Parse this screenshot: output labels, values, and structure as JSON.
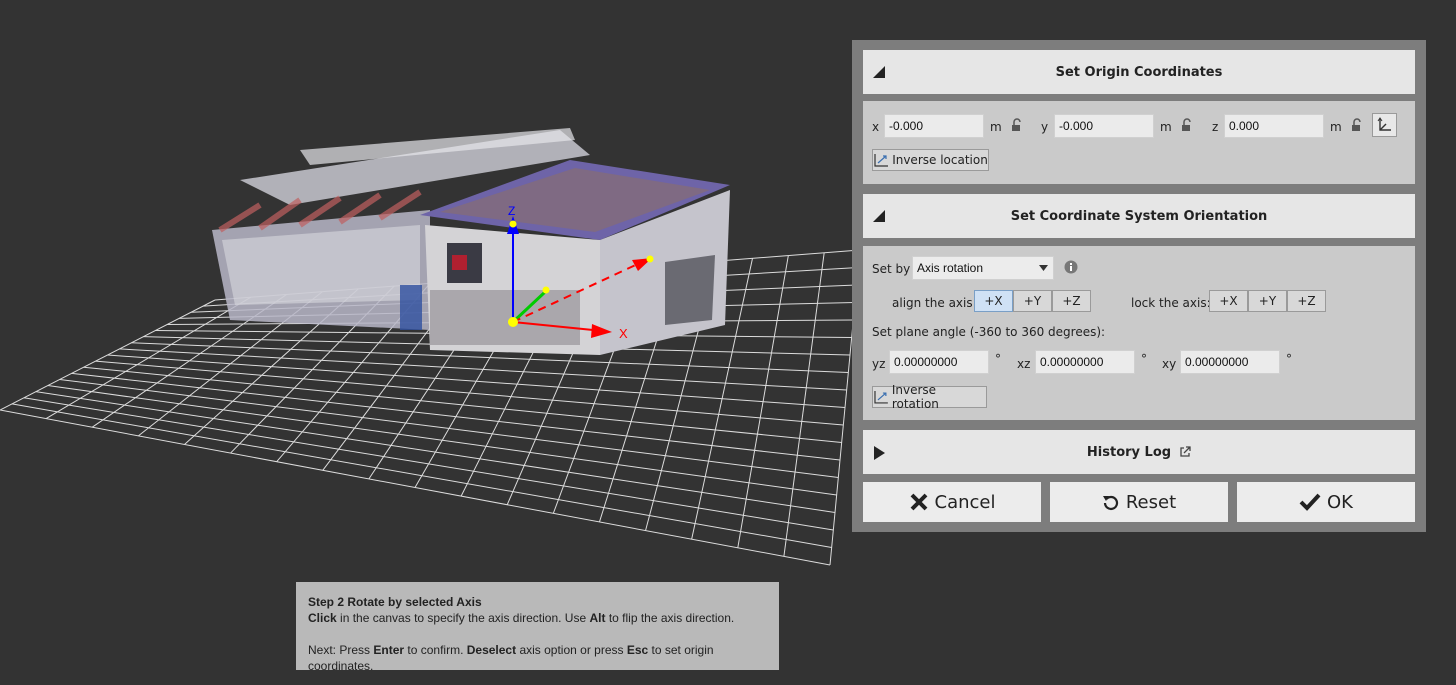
{
  "viewport": {
    "axis_labels": {
      "x": "X",
      "z": "Z"
    }
  },
  "origin_section": {
    "title": "Set Origin Coordinates",
    "x_label": "x",
    "x_value": "-0.000",
    "x_unit": "m",
    "y_label": "y",
    "y_value": "-0.000",
    "y_unit": "m",
    "z_label": "z",
    "z_value": "0.000",
    "z_unit": "m",
    "inverse_location_label": "Inverse location"
  },
  "orientation_section": {
    "title": "Set Coordinate System Orientation",
    "set_by_label": "Set by",
    "set_by_value": "Axis rotation",
    "align_label": "align the axis:",
    "align_options": [
      "+X",
      "+Y",
      "+Z"
    ],
    "align_selected": "+X",
    "lock_label": "lock the axis:",
    "lock_options": [
      "+X",
      "+Y",
      "+Z"
    ],
    "plane_angle_label": "Set plane angle (-360 to 360 degrees):",
    "yz_label": "yz",
    "yz_value": "0.00000000",
    "xz_label": "xz",
    "xz_value": "0.00000000",
    "xy_label": "xy",
    "xy_value": "0.00000000",
    "degree_symbol": "°",
    "inverse_rotation_label": "Inverse rotation"
  },
  "history_section": {
    "title": "History Log"
  },
  "footer": {
    "cancel_label": "Cancel",
    "reset_label": "Reset",
    "ok_label": "OK"
  },
  "hint": {
    "step_title": "Step 2 Rotate by selected Axis",
    "line1_bold": "Click",
    "line1_text": " in the canvas to specify the axis direction. Use ",
    "line1_bold2": "Alt",
    "line1_text2": " to flip the axis direction.",
    "line2_text": "Next: Press ",
    "line2_bold": "Enter",
    "line2_text2": " to confirm. ",
    "line2_bold2": "Deselect",
    "line2_text3": " axis option or press ",
    "line2_bold3": "Esc",
    "line2_text4": " to set origin coordinates."
  },
  "colors": {
    "background": "#333333",
    "x_axis": "#ff0000",
    "y_axis": "#00cc00",
    "z_axis": "#0000ff",
    "axis_point": "#ffff00"
  }
}
